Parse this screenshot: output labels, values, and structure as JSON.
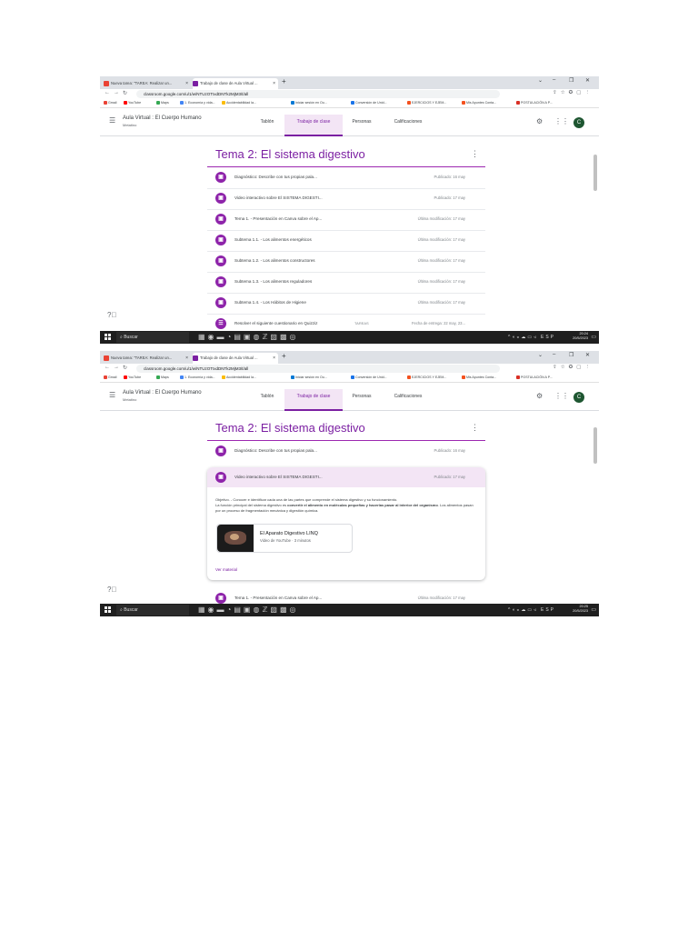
{
  "browser": {
    "tabs": [
      {
        "title": "Nueva tarea: \"TAREA: Realizar un...",
        "favicon": "gmail-icon"
      },
      {
        "title": "Trabajo de clase de Aula Virtual ...",
        "favicon": "classroom-icon"
      }
    ],
    "url": "classroom.google.com/u/1/w/NTUzOTIxdDNTk2MjM3/t/all",
    "bookmarks": [
      "Gmail",
      "YouTube",
      "Maps",
      "1. Economía y vida...",
      "Accidentabilidad la...",
      "Iniciar sesión en Ou...",
      "Conversión de Unid...",
      "EJERCICIOS Y EJEM...",
      "Mis Apuntes Conta...",
      "POSTULACIÓN A P..."
    ]
  },
  "header": {
    "course_title": "Aula Virtual : El Cuerpo Humano",
    "course_subtitle": "Metatino",
    "tabs": [
      "Tablón",
      "Trabajo de clase",
      "Personas",
      "Calificaciones"
    ],
    "active_tab": "Trabajo de clase",
    "avatar_letter": "C"
  },
  "topic": {
    "title": "Tema 2: El sistema digestivo",
    "items": [
      {
        "label": "Diagnóstico: Describe con tus propias pala...",
        "date": "Publicado: 16 may"
      },
      {
        "label": "Video interactivo sobre El SISTEMA DIGESTI...",
        "date": "Publicado: 17 may"
      },
      {
        "label": "Tema 1. - Presentación en Canva sobre el Ap...",
        "date": "Última modificación: 17 may"
      },
      {
        "label": "Subtema 1.1. - Los alimentos energéticos",
        "date": "Última modificación: 17 may"
      },
      {
        "label": "Subtema 1.2. - Los alimentos constructores",
        "date": "Última modificación: 17 may"
      },
      {
        "label": "Subtema 1.3. - Los alimentos reguladores",
        "date": "Última modificación: 17 may"
      },
      {
        "label": "Subtema 1.4. - Los Hábitos de Higiene",
        "date": "Última modificación: 17 may"
      },
      {
        "label": "Resolver el siguiente cuestionario en Quizziz",
        "type": "TAREAS",
        "date": "Fecha de entrega: 22 may, 23..."
      }
    ]
  },
  "expanded": {
    "label": "Video interactivo sobre El SISTEMA DIGESTI...",
    "date": "Publicado: 17 may",
    "desc_line1": "Objetivo. - Conocer e identificar cada una de las partes que comprende el sistema digestivo y su funcionamiento.",
    "desc_line2a": "La función principal del sistema digestivo es ",
    "desc_line2b": "convertir el alimento en moléculas pequeñas y hacerlas pasar al interior del organismo",
    "desc_line2c": ". Los alimentos pasan por un proceso de fragmentación mecánica y digestión química.",
    "attachment_title": "El Aparato Digestivo LINQ",
    "attachment_sub": "Video de YouTube · 3 minutos",
    "view_material": "Ver material"
  },
  "taskbar": {
    "search": "Buscar",
    "shot1_time": "20:24",
    "shot2_time": "20:25",
    "date": "20/5/2023",
    "lang": "ESP"
  }
}
